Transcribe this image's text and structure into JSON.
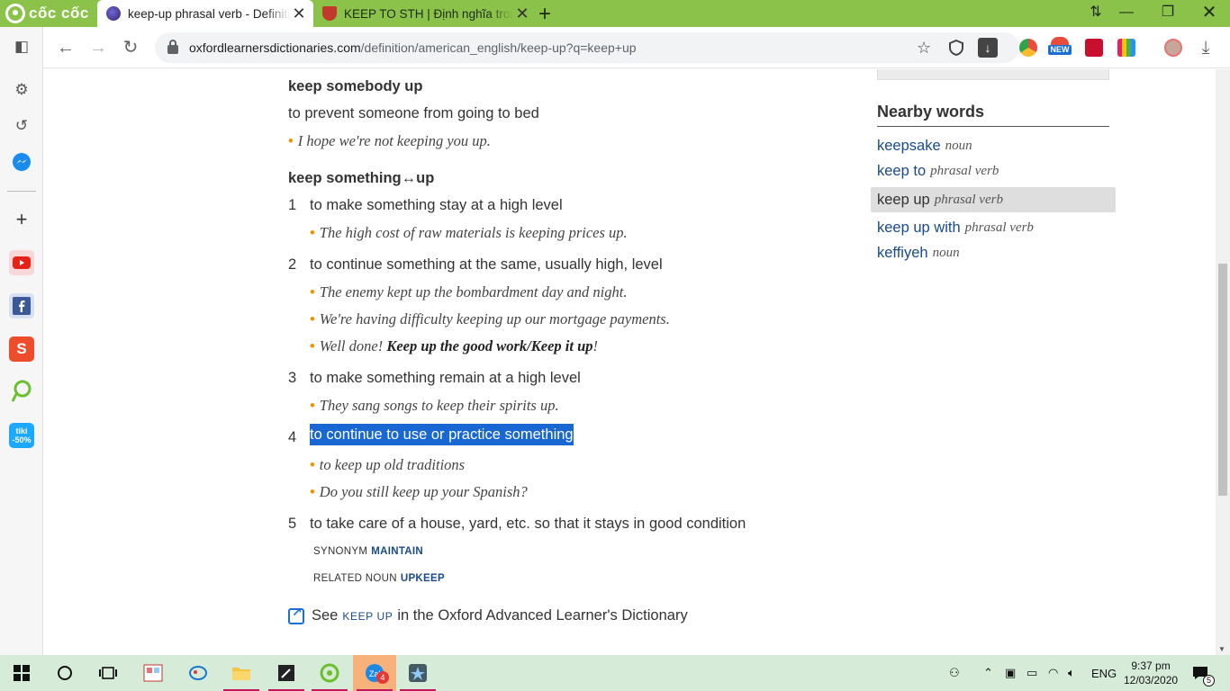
{
  "browser": {
    "brand": "cốc cốc",
    "tabs": [
      {
        "title": "keep-up phrasal verb - Definition",
        "favicon": "oxford-icon",
        "active": true
      },
      {
        "title": "KEEP TO STH | Định nghĩa trong",
        "favicon": "cambridge-icon",
        "active": false
      }
    ],
    "new_tab": "+",
    "url_domain": "oxfordlearnersdictionaries.com",
    "url_path": "/definition/american_english/keep-up?q=keep+up",
    "extensions_badge": "NEW"
  },
  "entry": {
    "sense_a": {
      "headword": "keep somebody up",
      "definition": "to prevent someone from going to bed",
      "example": "I hope we're not keeping you up."
    },
    "sense_b": {
      "headword": "keep something↔up",
      "senses": [
        {
          "num": "1",
          "definition": "to make something stay at a high level",
          "examples": [
            "The high cost of raw materials is keeping prices up."
          ]
        },
        {
          "num": "2",
          "definition": "to continue something at the same, usually high, level",
          "examples": [
            "The enemy kept up the bombardment day and night.",
            "We're having difficulty keeping up our mortgage payments."
          ],
          "example_bold": {
            "pre": "Well done! ",
            "bold": "Keep up the good work/Keep it up",
            "post": "!"
          }
        },
        {
          "num": "3",
          "definition": "to make something remain at a high level",
          "examples": [
            "They sang songs to keep their spirits up."
          ]
        },
        {
          "num": "4",
          "definition": "to continue to use or practice something",
          "examples": [
            "to keep up old traditions",
            "Do you still keep up your Spanish?"
          ]
        },
        {
          "num": "5",
          "definition": "to take care of a house, yard, etc. so that it stays in good condition",
          "synonym_label": "SYNONYM",
          "synonym": "MAINTAIN",
          "related_label": "RELATED NOUN",
          "related": "UPKEEP"
        }
      ]
    },
    "see_also": {
      "pre": "See",
      "link": "KEEP UP",
      "post": "in the Oxford Advanced Learner's Dictionary"
    }
  },
  "nearby": {
    "title": "Nearby words",
    "items": [
      {
        "word": "keepsake",
        "pos": "noun"
      },
      {
        "word": "keep to",
        "pos": "phrasal verb"
      },
      {
        "word": "keep up",
        "pos": "phrasal verb",
        "current": true
      },
      {
        "word": "keep up with",
        "pos": "phrasal verb"
      },
      {
        "word": "keffiyeh",
        "pos": "noun"
      }
    ]
  },
  "taskbar": {
    "badge_count": "4",
    "language": "ENG",
    "time": "9:37 pm",
    "date": "12/03/2020",
    "notifications": "5"
  },
  "colors": {
    "tab_strip": "#8bc34a",
    "link": "#1a4a8a",
    "bullet": "#f39200",
    "selection": "#1967d2",
    "taskbar": "#d6ecd8"
  }
}
